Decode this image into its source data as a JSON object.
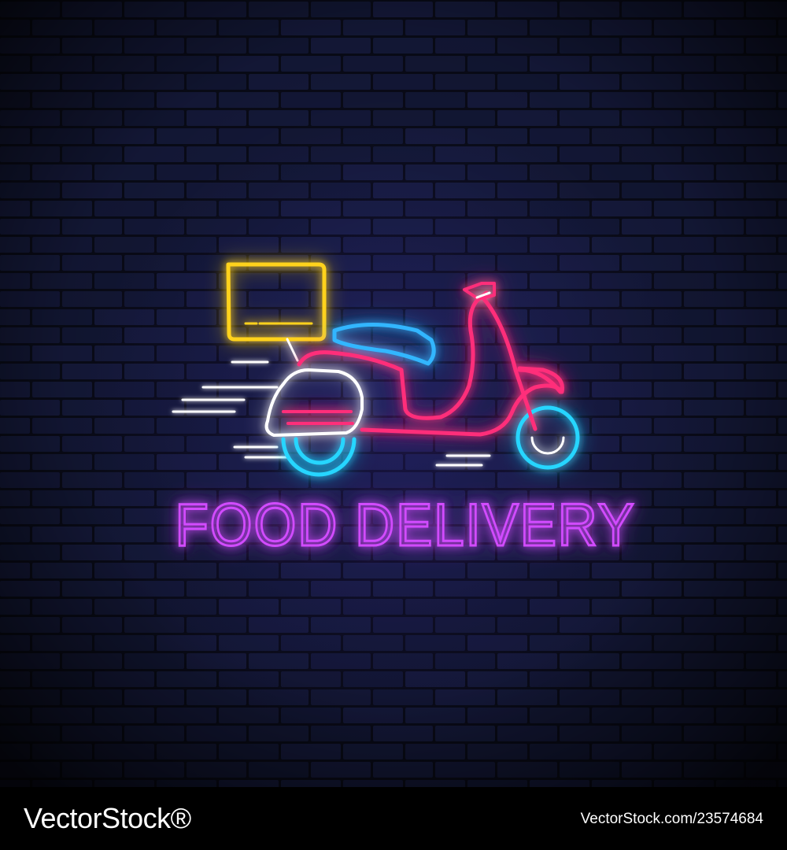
{
  "sign": {
    "text": "FOOD DELIVERY",
    "icon": "scooter-icon",
    "box_icon": "delivery-box-icon"
  },
  "colors": {
    "wall_bg": "#0b0d1c",
    "brick": "#1a2049",
    "mortar": "#070914",
    "text_neon": "#d24cff",
    "box_neon": "#ffd21f",
    "scooter_neon": "#ff2f7a",
    "seat_neon": "#33b6ff",
    "wheel_neon": "#28d6ff",
    "speed_lines": "#ffffff"
  },
  "watermark": {
    "brand": "VectorStock®",
    "image_id": "VectorStock.com/23574684"
  }
}
